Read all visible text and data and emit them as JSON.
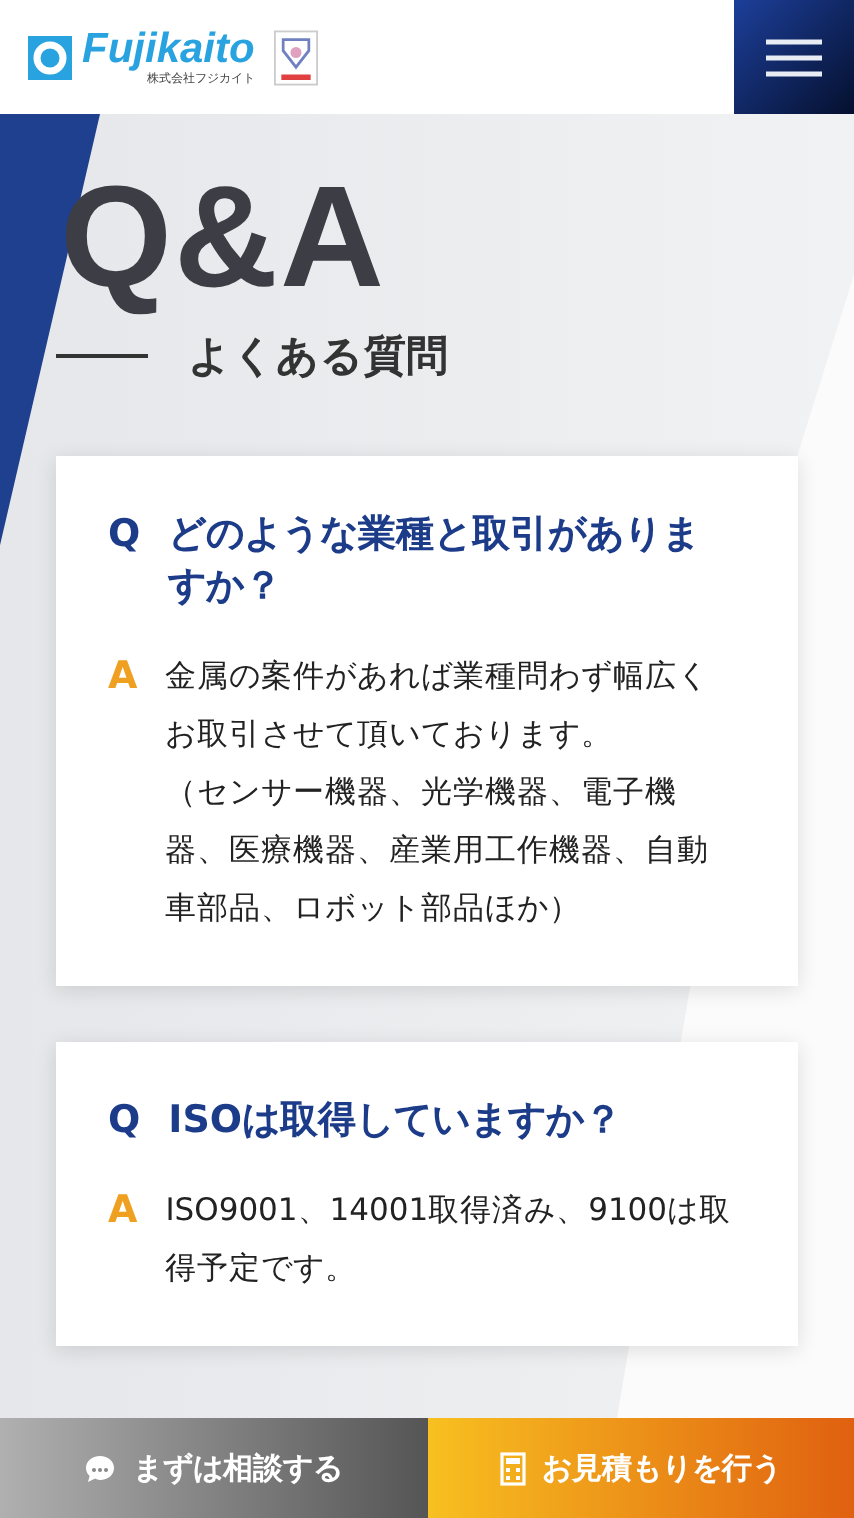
{
  "header": {
    "logo": "Fujikaito",
    "logo_sub": "株式会社フジカイト"
  },
  "hero": {
    "title": "Q&A",
    "subtitle": "よくある質問"
  },
  "faqs": [
    {
      "q_mark": "Q",
      "question": "どのような業種と取引がありますか？",
      "a_mark": "A",
      "answer": [
        "金属の案件があれば業種問わず幅広くお取引させて頂いております。",
        "（センサー機器、光学機器、電子機器、医療機器、産業用工作機器、自動車部品、ロボット部品ほか）"
      ]
    },
    {
      "q_mark": "Q",
      "question": "ISOは取得していますか？",
      "a_mark": "A",
      "answer": [
        "ISO9001、14001取得済み、9100は取得予定です。"
      ]
    }
  ],
  "bottom_bar": [
    {
      "kind": "consult",
      "label": "まずは相談する"
    },
    {
      "kind": "estimate",
      "label": "お見積もりを行う"
    }
  ]
}
